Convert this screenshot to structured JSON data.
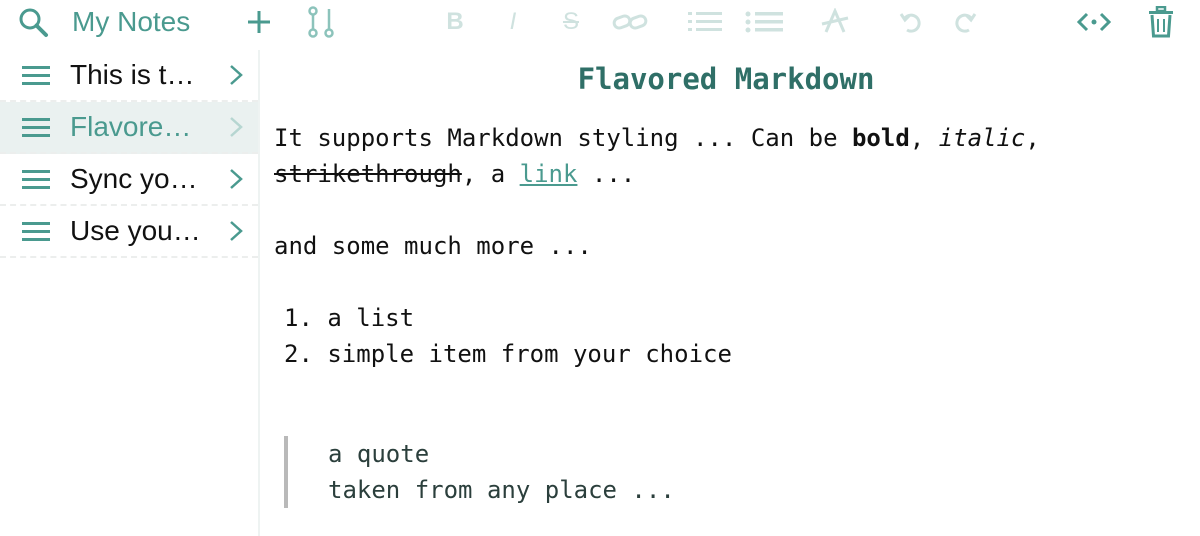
{
  "colors": {
    "accent": "#4a9a8f",
    "title": "#2f6f67",
    "disabled": "#cfe2df"
  },
  "toolbar": {
    "title": "My Notes",
    "icons": [
      "search-icon",
      "add-icon",
      "branch-icon",
      "bold-icon",
      "italic-icon",
      "strikethrough-icon",
      "link-icon",
      "ordered-list-icon",
      "bullet-list-icon",
      "clear-format-icon",
      "undo-icon",
      "redo-icon",
      "code-view-icon",
      "trash-icon"
    ],
    "format_letters": {
      "bold": "B",
      "italic": "I",
      "strike": "S"
    }
  },
  "sidebar": {
    "items": [
      {
        "label": "This is t…"
      },
      {
        "label": "Flavore…"
      },
      {
        "label": "Sync yo…"
      },
      {
        "label": "Use you…"
      }
    ]
  },
  "note": {
    "title": "Flavored Markdown",
    "p1_a": "It supports Markdown styling ... Can be ",
    "p1_bold": "bold",
    "p1_b": ", ",
    "p1_italic": "italic",
    "p1_c": ",",
    "p2_strike": "strikethrough",
    "p2_a": ", a ",
    "p2_link": "link",
    "p2_b": " ...",
    "p3": "and some much more ...",
    "list": [
      "1. a list",
      "2. simple item from your choice"
    ],
    "quote": [
      "a quote",
      "taken from any place ..."
    ]
  }
}
